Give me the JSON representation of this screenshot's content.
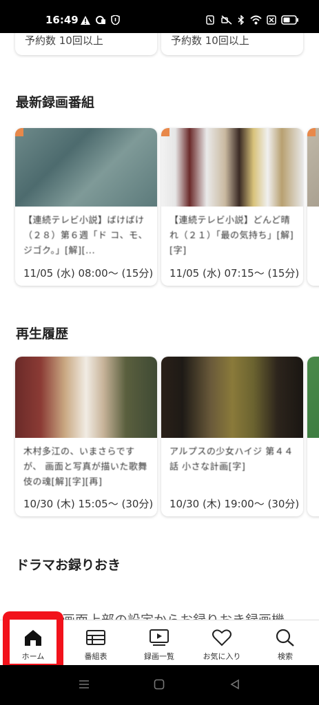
{
  "status_bar": {
    "time": "16:49",
    "icons": [
      "warning-icon",
      "lock-ring-icon",
      "shield-icon",
      "nfc-icon",
      "mute-icon",
      "bluetooth-icon",
      "wifi-icon",
      "close-box-icon",
      "battery-icon"
    ]
  },
  "top_cards": [
    {
      "stub": "予約数 10回以上"
    },
    {
      "stub": "予約数 10回以上"
    }
  ],
  "latest_recordings": {
    "title": "最新録画番組",
    "items": [
      {
        "title": "【連続テレビ小説】ばけばけ（２８）第６週「ド コ、モ、ジゴク。」[解][...",
        "time": "11/05 (水) 08:00〜 (15分)"
      },
      {
        "title": "【連続テレビ小説】どんど晴れ（２１）「最の気持ち」[解][字]",
        "time": "11/05 (水) 07:15〜 (15分)"
      }
    ]
  },
  "history": {
    "title": "再生履歴",
    "items": [
      {
        "title": "木村多江の、いまさらですが、 画面と写真が描いた歌舞伎の魂[解][字][再]",
        "time": "10/30 (木) 15:05〜 (30分)"
      },
      {
        "title": "アルプスの少女ハイジ 第４４話 小さな計画[字]",
        "time": "10/30 (木) 19:00〜 (30分)"
      }
    ]
  },
  "drama": {
    "title": "ドラマお録りおき",
    "peek_text": "画面上部の設定からお録りおき録画機"
  },
  "bottom_nav": [
    {
      "label": "ホーム",
      "icon": "home-icon"
    },
    {
      "label": "番組表",
      "icon": "program-guide-icon"
    },
    {
      "label": "録画一覧",
      "icon": "recordings-icon"
    },
    {
      "label": "お気に入り",
      "icon": "heart-icon"
    },
    {
      "label": "検索",
      "icon": "search-icon"
    }
  ],
  "colors": {
    "accent_red": "#f2121b",
    "badge_orange": "#e8884a"
  }
}
